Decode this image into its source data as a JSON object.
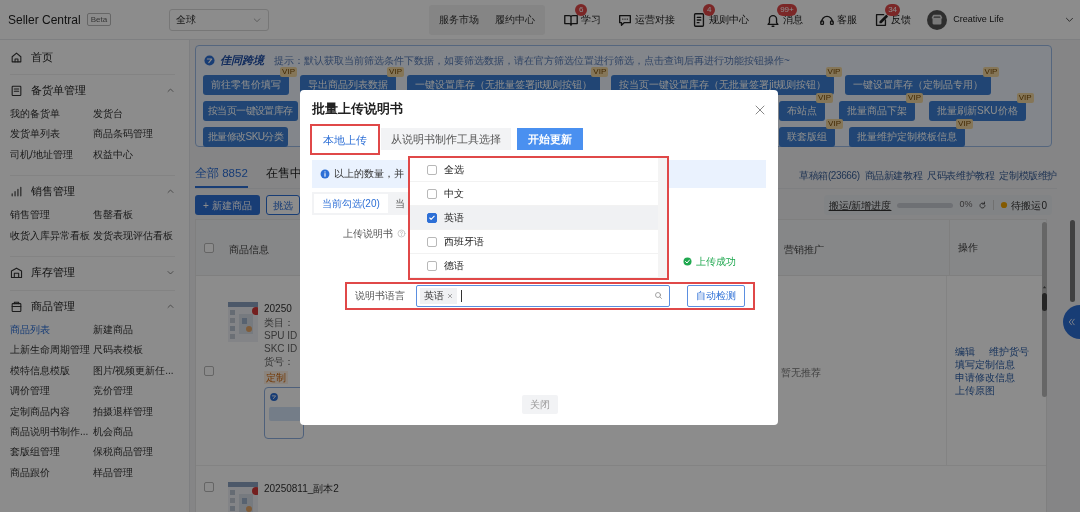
{
  "top_bar": {
    "brand": "Seller Central",
    "badge": "Beta",
    "region_select": "全球",
    "nav_buttons": [
      "服务市场",
      "履约中心"
    ],
    "nav_items": [
      {
        "label": "学习",
        "count": "6"
      },
      {
        "label": "运营对接"
      },
      {
        "label": "规则中心",
        "count": "4"
      },
      {
        "label": "消息",
        "count": "99+"
      },
      {
        "label": "客服"
      },
      {
        "label": "反馈",
        "count": "34"
      }
    ],
    "user": "Creative Life"
  },
  "sidebar": {
    "home": "首页",
    "groups": [
      {
        "title": "备货单管理",
        "expanded": true,
        "links": [
          {
            "label": "我的备货单",
            "selected": false
          },
          {
            "label": "发货台",
            "selected": false
          },
          {
            "label": "发货单列表",
            "selected": false
          },
          {
            "label": "商品条码管理",
            "selected": false
          },
          {
            "label": "司机/地址管理",
            "selected": false
          },
          {
            "label": "权益中心",
            "selected": false
          }
        ]
      },
      {
        "title": "销售管理",
        "expanded": true,
        "links": [
          {
            "label": "销售管理",
            "selected": false
          },
          {
            "label": "售罄看板",
            "selected": false
          },
          {
            "label": "收货入库异常看板",
            "selected": false
          },
          {
            "label": "发货表现评估看板",
            "selected": false
          }
        ]
      },
      {
        "title": "库存管理",
        "expanded": false
      },
      {
        "title": "商品管理",
        "expanded": true,
        "links": [
          {
            "label": "商品列表",
            "selected": true
          },
          {
            "label": "新建商品",
            "selected": false
          },
          {
            "label": "上新生命周期管理",
            "selected": false
          },
          {
            "label": "尺码表模板",
            "selected": false
          },
          {
            "label": "模特信息模版",
            "selected": false
          },
          {
            "label": "图片/视频更新任...",
            "selected": false
          },
          {
            "label": "调价管理",
            "selected": false
          },
          {
            "label": "竞价管理",
            "selected": false
          },
          {
            "label": "定制商品内容",
            "selected": false
          },
          {
            "label": "拍摄退样管理",
            "selected": false
          },
          {
            "label": "商品说明书制作...",
            "selected": false
          },
          {
            "label": "机会商品",
            "selected": false
          },
          {
            "label": "套版组管理",
            "selected": false
          },
          {
            "label": "保税商品管理",
            "selected": false
          },
          {
            "label": "商品跟价",
            "selected": false
          },
          {
            "label": "样品管理",
            "selected": false
          }
        ]
      }
    ]
  },
  "toolbar": {
    "logo": "佳同跨境",
    "tip": "提示：默认获取当前筛选条件下数据，如要筛选数据，请在官方筛选位置进行筛选，点击查询后再进行功能按钮操作~",
    "rows": [
      {
        "left": [
          {
            "label": "前往零售价填写",
            "badge": "VIP"
          },
          {
            "label": "导出商品列表数据",
            "badge": "VIP"
          },
          {
            "label": "一键设置库存（无批量签署jit规则按钮）",
            "badge": "VIP"
          },
          {
            "label": "按当页一键设置库存（无批量签署jit规则按钮）",
            "badge": "VIP"
          },
          {
            "label": "一键设置库存（定制品专用）",
            "badge": "VIP"
          }
        ],
        "right": []
      },
      {
        "left": [
          {
            "label": "按当页一键设置库存"
          }
        ],
        "right": [
          {
            "label": "布站点",
            "badge": "VIP"
          },
          {
            "label": "批量商品下架",
            "badge": "VIP"
          },
          {
            "label": "批量刷新SKU价格",
            "badge": "VIP"
          }
        ]
      },
      {
        "left": [
          {
            "label": "批量修改SKU分类"
          }
        ],
        "right": [
          {
            "label": "联套版组",
            "badge": "VIP"
          },
          {
            "label": "批量维护定制模板信息",
            "badge": "VIP"
          }
        ]
      }
    ]
  },
  "products": {
    "tabs": [
      {
        "label": "全部 8852",
        "selected": true
      },
      {
        "label": "在售中",
        "selected": false
      }
    ],
    "links": [
      "草稿箱(23666)",
      "商品新建教程",
      "尺码表维护教程",
      "定制模版维护"
    ],
    "new_button": "+ 新建商品",
    "pick_button": "挑选",
    "progress": {
      "label": "搬运/新增进度",
      "level": 0,
      "reading": "0%",
      "pending": "待搬运0"
    },
    "select_all_checked": false,
    "columns": [
      "商品信息",
      "营销推广",
      "操作"
    ],
    "rows": [
      {
        "checked": false,
        "title": "20250",
        "details": [
          "类目：",
          "SPU ID",
          "SKC ID",
          "货号："
        ],
        "tag": "定制",
        "promotion": "暂无推荐",
        "actions": [
          "编辑",
          "维护货号",
          "填写定制信息",
          "申请修改信息",
          "上传原图"
        ]
      },
      {
        "checked": false,
        "title": "20250811_副本2"
      }
    ]
  },
  "modal": {
    "title": "批量上传说明书",
    "tabs": [
      {
        "label": "本地上传",
        "selected": true
      },
      {
        "label": "从说明书制作工具选择",
        "selected": false
      }
    ],
    "start_button": "开始更新",
    "notice": "以上的数量，并",
    "scope_tabs": [
      {
        "label": "当前勾选(20)",
        "selected": true
      },
      {
        "label": "当",
        "selected": false
      }
    ],
    "upload_label": "上传说明书",
    "upload_status": "上传成功",
    "language_field": {
      "label": "说明书语言",
      "tags": [
        "英语"
      ]
    },
    "detect_button": "自动检测",
    "language_options": [
      {
        "label": "全选",
        "checked": false
      },
      {
        "label": "中文",
        "checked": false
      },
      {
        "label": "英语",
        "checked": true
      },
      {
        "label": "西班牙语",
        "checked": false
      },
      {
        "label": "德语",
        "checked": false
      }
    ],
    "close_button": "关闭"
  }
}
